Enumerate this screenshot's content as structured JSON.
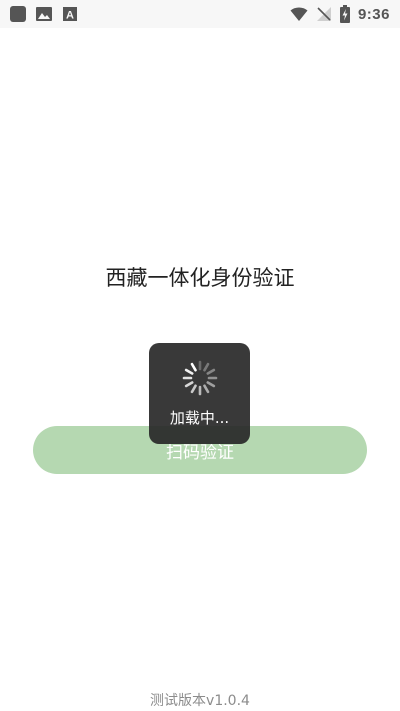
{
  "status_bar": {
    "time": "9:36",
    "left_icons": [
      "app-square-icon",
      "image-icon",
      "a-badge-icon"
    ],
    "right_icons": [
      "wifi-icon",
      "no-signal-icon",
      "battery-charging-icon"
    ]
  },
  "main": {
    "title": "西藏一体化身份验证",
    "scan_button_label": "扫码验证"
  },
  "loading": {
    "text": "加载中..."
  },
  "footer": {
    "version": "测试版本v1.0.4"
  },
  "colors": {
    "button_bg": "#b5d8b1",
    "toast_bg": "#282828",
    "title_text": "#222222",
    "version_text": "#8c8c8c"
  }
}
